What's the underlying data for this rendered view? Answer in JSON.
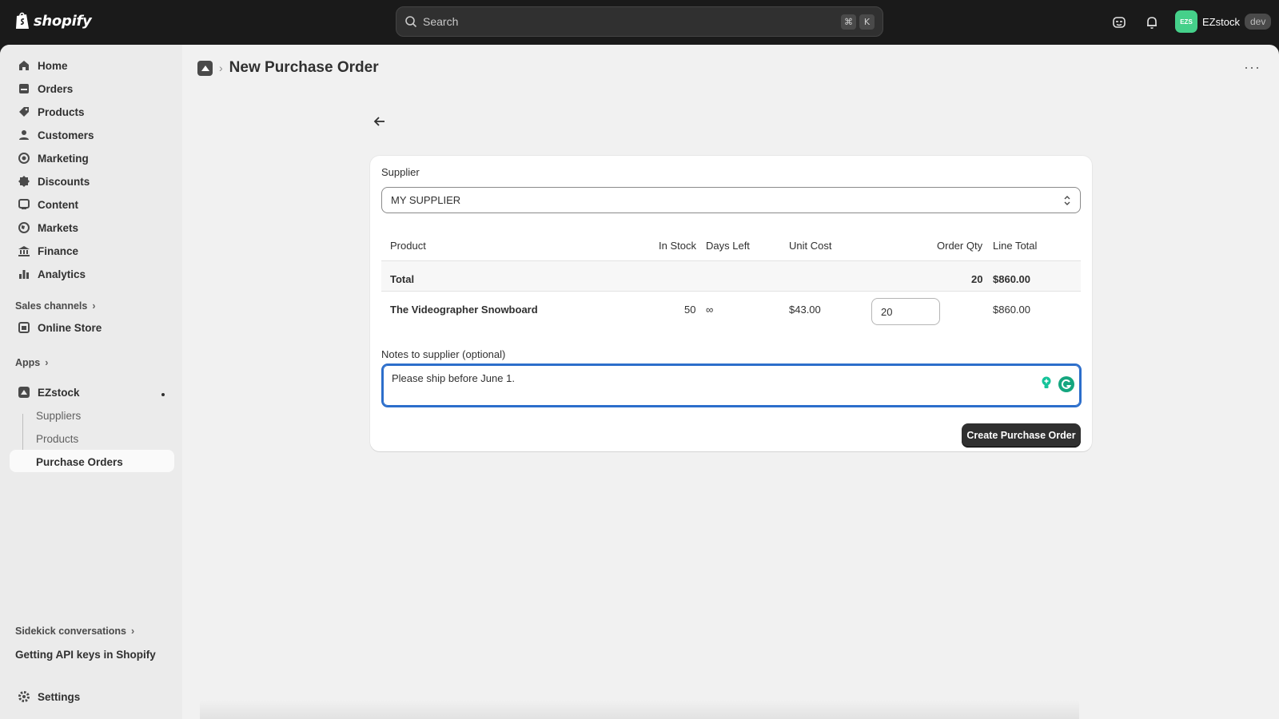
{
  "topbar": {
    "logo_text": "shopify",
    "search_placeholder": "Search",
    "shortcut_keys": [
      "⌘",
      "K"
    ],
    "user_initials": "EZS",
    "user_name": "EZstock",
    "env_badge": "dev"
  },
  "sidebar": {
    "nav": [
      {
        "label": "Home",
        "icon": "home-icon"
      },
      {
        "label": "Orders",
        "icon": "orders-icon"
      },
      {
        "label": "Products",
        "icon": "tag-icon"
      },
      {
        "label": "Customers",
        "icon": "person-icon"
      },
      {
        "label": "Marketing",
        "icon": "target-icon"
      },
      {
        "label": "Discounts",
        "icon": "discount-icon"
      },
      {
        "label": "Content",
        "icon": "content-icon"
      },
      {
        "label": "Markets",
        "icon": "globe-icon"
      },
      {
        "label": "Finance",
        "icon": "bank-icon"
      },
      {
        "label": "Analytics",
        "icon": "bar-chart-icon"
      }
    ],
    "sales_channels_label": "Sales channels",
    "online_store_label": "Online Store",
    "apps_label": "Apps",
    "app_name": "EZstock",
    "app_sub_items": [
      "Suppliers",
      "Products",
      "Purchase Orders"
    ],
    "sidekick_label": "Sidekick conversations",
    "sidekick_item": "Getting API keys in Shopify",
    "settings_label": "Settings"
  },
  "page": {
    "title": "New Purchase Order",
    "supplier_label": "Supplier",
    "supplier_value": "MY SUPPLIER",
    "columns": [
      "Product",
      "In Stock",
      "Days Left",
      "Unit Cost",
      "Order Qty",
      "Line Total"
    ],
    "total_row": {
      "label": "Total",
      "qty": "20",
      "line_total": "$860.00"
    },
    "rows": [
      {
        "product": "The Videographer Snowboard",
        "in_stock": "50",
        "days_left": "∞",
        "unit_cost": "$43.00",
        "order_qty": "20",
        "line_total": "$860.00"
      }
    ],
    "notes_label": "Notes to supplier (optional)",
    "notes_value": "Please ship before June 1.",
    "create_button": "Create Purchase Order"
  },
  "colors": {
    "accent_focus": "#2c6ecb",
    "avatar": "#45d08a",
    "primary_button": "#303030"
  }
}
